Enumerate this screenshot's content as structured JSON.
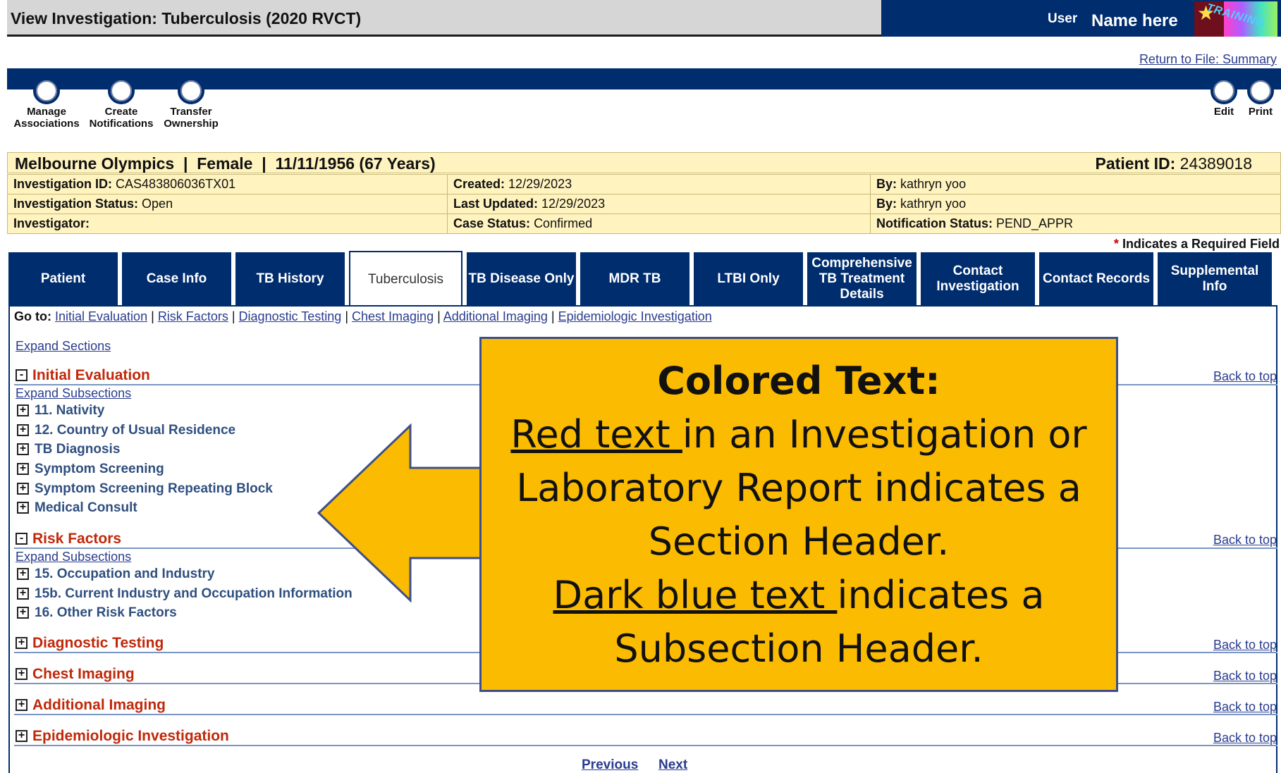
{
  "header": {
    "title": "View Investigation: Tuberculosis (2020 RVCT)",
    "user_label": "User",
    "user_name": "Name here"
  },
  "return_link": "Return to File: Summary",
  "actions": {
    "manage_associations": [
      "Manage",
      "Associations"
    ],
    "create_notifications": [
      "Create",
      "Notifications"
    ],
    "transfer_ownership": [
      "Transfer",
      "Ownership"
    ],
    "edit": "Edit",
    "print": "Print"
  },
  "patient": {
    "summary": "Melbourne Olympics  |  Female  |  11/11/1956 (67 Years)",
    "id_label": "Patient ID:",
    "id_value": "24389018"
  },
  "investigation": {
    "id_label": "Investigation ID:",
    "id_value": "CAS483806036TX01",
    "created_label": "Created:",
    "created_value": "12/29/2023",
    "by1_label": "By:",
    "by1_value": "kathryn yoo",
    "status_label": "Investigation Status:",
    "status_value": "Open",
    "updated_label": "Last Updated:",
    "updated_value": "12/29/2023",
    "by2_label": "By:",
    "by2_value": "kathryn yoo",
    "investigator_label": "Investigator:",
    "investigator_value": "",
    "case_status_label": "Case Status:",
    "case_status_value": "Confirmed",
    "notification_label": "Notification Status:",
    "notification_value": "PEND_APPR"
  },
  "required_note": {
    "star": "*",
    "text": "Indicates a Required Field"
  },
  "tabs": [
    {
      "label": "Patient"
    },
    {
      "label": "Case Info"
    },
    {
      "label": "TB History"
    },
    {
      "label": "Tuberculosis"
    },
    {
      "label": "TB Disease Only"
    },
    {
      "label": "MDR TB"
    },
    {
      "label": "LTBI Only"
    },
    {
      "label": "Comprehensive TB Treatment Details"
    },
    {
      "label": "Contact Investigation"
    },
    {
      "label": "Contact Records"
    },
    {
      "label": "Supplemental Info"
    }
  ],
  "goto": {
    "label": "Go to:",
    "separator": "|",
    "links": [
      "Initial Evaluation",
      "Risk Factors",
      "Diagnostic Testing",
      "Chest Imaging",
      "Additional Imaging",
      "Epidemiologic Investigation"
    ]
  },
  "expand_sections": "Expand Sections",
  "expand_subsections": "Expand Subsections",
  "back_to_top": "Back to top",
  "collapse_symbol": "-",
  "expand_symbol": "+",
  "sections": {
    "initial_evaluation": {
      "title": "Initial Evaluation",
      "subsections": [
        "11. Nativity",
        "12. Country of Usual Residence",
        "TB Diagnosis",
        "Symptom Screening",
        "Symptom Screening Repeating Block",
        "Medical Consult"
      ]
    },
    "risk_factors": {
      "title": "Risk Factors",
      "subsections": [
        "15. Occupation and Industry",
        "15b. Current Industry and Occupation Information",
        "16. Other Risk Factors"
      ]
    },
    "diagnostic_testing": {
      "title": "Diagnostic Testing"
    },
    "chest_imaging": {
      "title": "Chest Imaging"
    },
    "additional_imaging": {
      "title": "Additional Imaging"
    },
    "epidemiologic_investigation": {
      "title": "Epidemiologic Investigation"
    }
  },
  "pager": {
    "previous": "Previous",
    "next": "Next"
  },
  "callout": {
    "heading": "Colored Text:",
    "red_text": "Red text ",
    "line1_rest": "in an Investigation or",
    "line2": "Laboratory Report indicates a",
    "line3": "Section Header.",
    "blue_text": "Dark blue text ",
    "line4_rest": "indicates a",
    "line5": "Subsection Header."
  },
  "colors": {
    "nav_blue": "#002d6e",
    "section_red": "#c0280a",
    "subsection_blue": "#2f4f7f",
    "callout_yellow": "#fbbb00",
    "banner_yellow": "#fff3bf"
  }
}
